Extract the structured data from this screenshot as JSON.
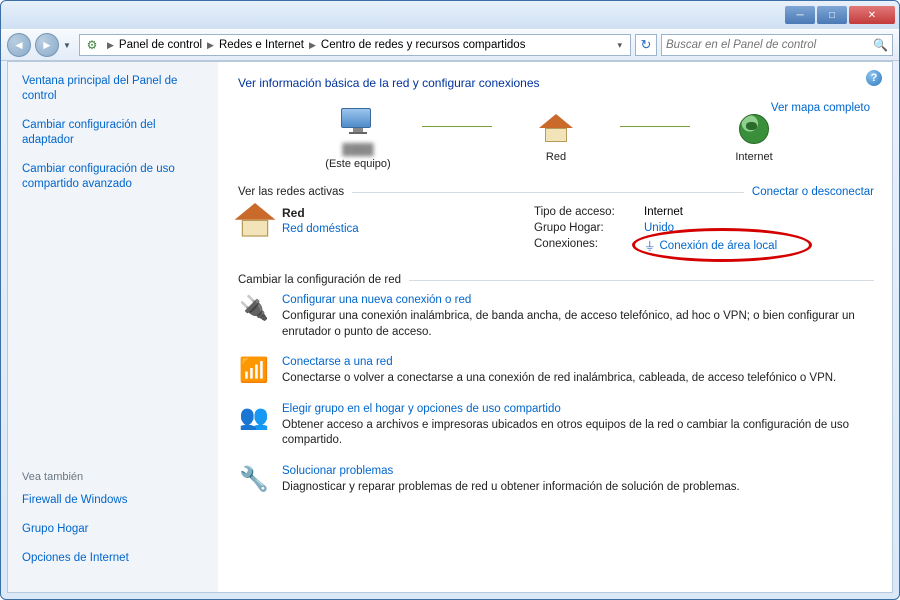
{
  "breadcrumb": {
    "items": [
      "Panel de control",
      "Redes e Internet",
      "Centro de redes y recursos compartidos"
    ]
  },
  "search": {
    "placeholder": "Buscar en el Panel de control"
  },
  "sidebar": {
    "links": [
      "Ventana principal del Panel de control",
      "Cambiar configuración del adaptador",
      "Cambiar configuración de uso compartido avanzado"
    ],
    "see_also_label": "Vea también",
    "see_also": [
      "Firewall de Windows",
      "Grupo Hogar",
      "Opciones de Internet"
    ]
  },
  "heading": "Ver información básica de la red y configurar conexiones",
  "map": {
    "this_computer": "(Este equipo)",
    "network_label": "Red",
    "internet_label": "Internet",
    "full_map_link": "Ver mapa completo"
  },
  "active": {
    "header": "Ver las redes activas",
    "action": "Conectar o desconectar",
    "network_name": "Red",
    "network_type": "Red doméstica",
    "access_label": "Tipo de acceso:",
    "access_value": "Internet",
    "homegroup_label": "Grupo Hogar:",
    "homegroup_value": "Unido",
    "connections_label": "Conexiones:",
    "connection_name": "Conexión de área local"
  },
  "change": {
    "header": "Cambiar la configuración de red",
    "tasks": [
      {
        "title": "Configurar una nueva conexión o red",
        "desc": "Configurar una conexión inalámbrica, de banda ancha, de acceso telefónico, ad hoc o VPN; o bien configurar un enrutador o punto de acceso.",
        "icon": "🔌"
      },
      {
        "title": "Conectarse a una red",
        "desc": "Conectarse o volver a conectarse a una conexión de red inalámbrica, cableada, de acceso telefónico o VPN.",
        "icon": "📶"
      },
      {
        "title": "Elegir grupo en el hogar y opciones de uso compartido",
        "desc": "Obtener acceso a archivos e impresoras ubicados en otros equipos de la red o cambiar la configuración de uso compartido.",
        "icon": "👥"
      },
      {
        "title": "Solucionar problemas",
        "desc": "Diagnosticar y reparar problemas de red u obtener información de solución de problemas.",
        "icon": "🔧"
      }
    ]
  }
}
